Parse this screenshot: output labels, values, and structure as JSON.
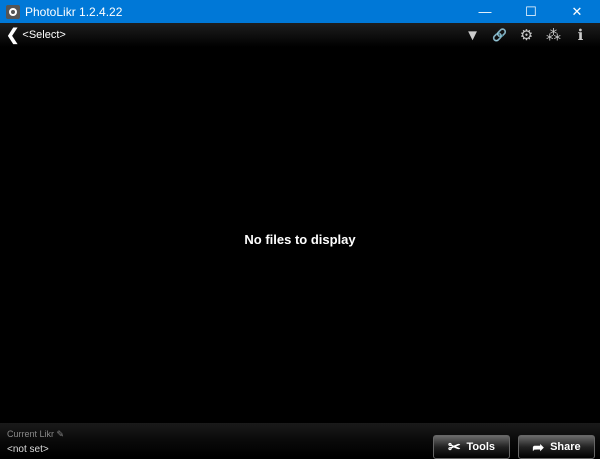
{
  "window": {
    "title": "PhotoLikr 1.2.4.22",
    "minimize": "—",
    "maximize": "☐",
    "close": "✕"
  },
  "toolbar": {
    "back": "❮",
    "select": "<Select>",
    "icons": [
      {
        "name": "filter-icon",
        "glyph": "▼"
      },
      {
        "name": "link-icon",
        "glyph": "🔗"
      },
      {
        "name": "gear-icon",
        "glyph": "⚙"
      },
      {
        "name": "rating-stars-icon",
        "glyph": "⁂"
      },
      {
        "name": "info-icon",
        "glyph": "ℹ"
      }
    ]
  },
  "main": {
    "empty_message": "No files to display"
  },
  "footer": {
    "current_label": "Current Likr",
    "current_value": "<not set>",
    "tools": "Tools",
    "share": "Share"
  }
}
